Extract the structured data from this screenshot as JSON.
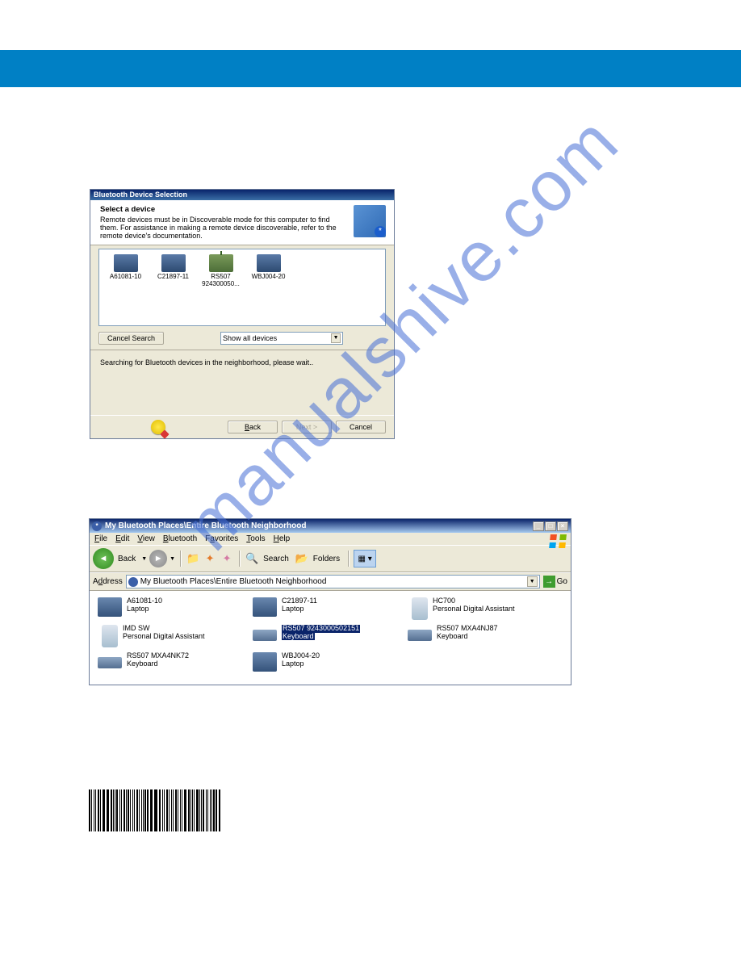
{
  "watermark": "manualshive.com",
  "dialog1": {
    "title": "Bluetooth Device Selection",
    "header_bold": "Select a device",
    "header_text": "Remote devices must be in Discoverable mode for this computer to find them. For assistance in making a remote device discoverable, refer to the remote device's documentation.",
    "devices": [
      {
        "name": "A61081-10",
        "type": "laptop"
      },
      {
        "name": "C21897-11",
        "type": "laptop"
      },
      {
        "name": "RS507 924300050...",
        "type": "router"
      },
      {
        "name": "WBJ004-20",
        "type": "laptop"
      }
    ],
    "cancel_search": "Cancel Search",
    "dropdown": "Show all devices",
    "status": "Searching for Bluetooth devices in the neighborhood, please wait..",
    "back": "< Back",
    "next": "Next >",
    "cancel": "Cancel"
  },
  "explorer": {
    "title": "My Bluetooth Places\\Entire Bluetooth Neighborhood",
    "menus": {
      "file": "File",
      "edit": "Edit",
      "view": "View",
      "bluetooth": "Bluetooth",
      "favorites": "Favorites",
      "tools": "Tools",
      "help": "Help"
    },
    "back": "Back",
    "search": "Search",
    "folders": "Folders",
    "address_label": "Address",
    "address_value": "My Bluetooth Places\\Entire Bluetooth Neighborhood",
    "go": "Go",
    "items": [
      {
        "name": "A61081-10",
        "sub": "Laptop",
        "icon": "laptop"
      },
      {
        "name": "C21897-11",
        "sub": "Laptop",
        "icon": "laptop"
      },
      {
        "name": "HC700",
        "sub": "Personal Digital Assistant",
        "icon": "pda"
      },
      {
        "name": "IMD SW",
        "sub": "Personal Digital Assistant",
        "icon": "pda"
      },
      {
        "name": "RS507 9243000502151",
        "sub": "Keyboard",
        "icon": "keyboard",
        "selected": true
      },
      {
        "name": "RS507 MXA4NJ87",
        "sub": "Keyboard",
        "icon": "keyboard"
      },
      {
        "name": "RS507 MXA4NK72",
        "sub": "Keyboard",
        "icon": "keyboard"
      },
      {
        "name": "WBJ004-20",
        "sub": "Laptop",
        "icon": "laptop"
      }
    ]
  }
}
